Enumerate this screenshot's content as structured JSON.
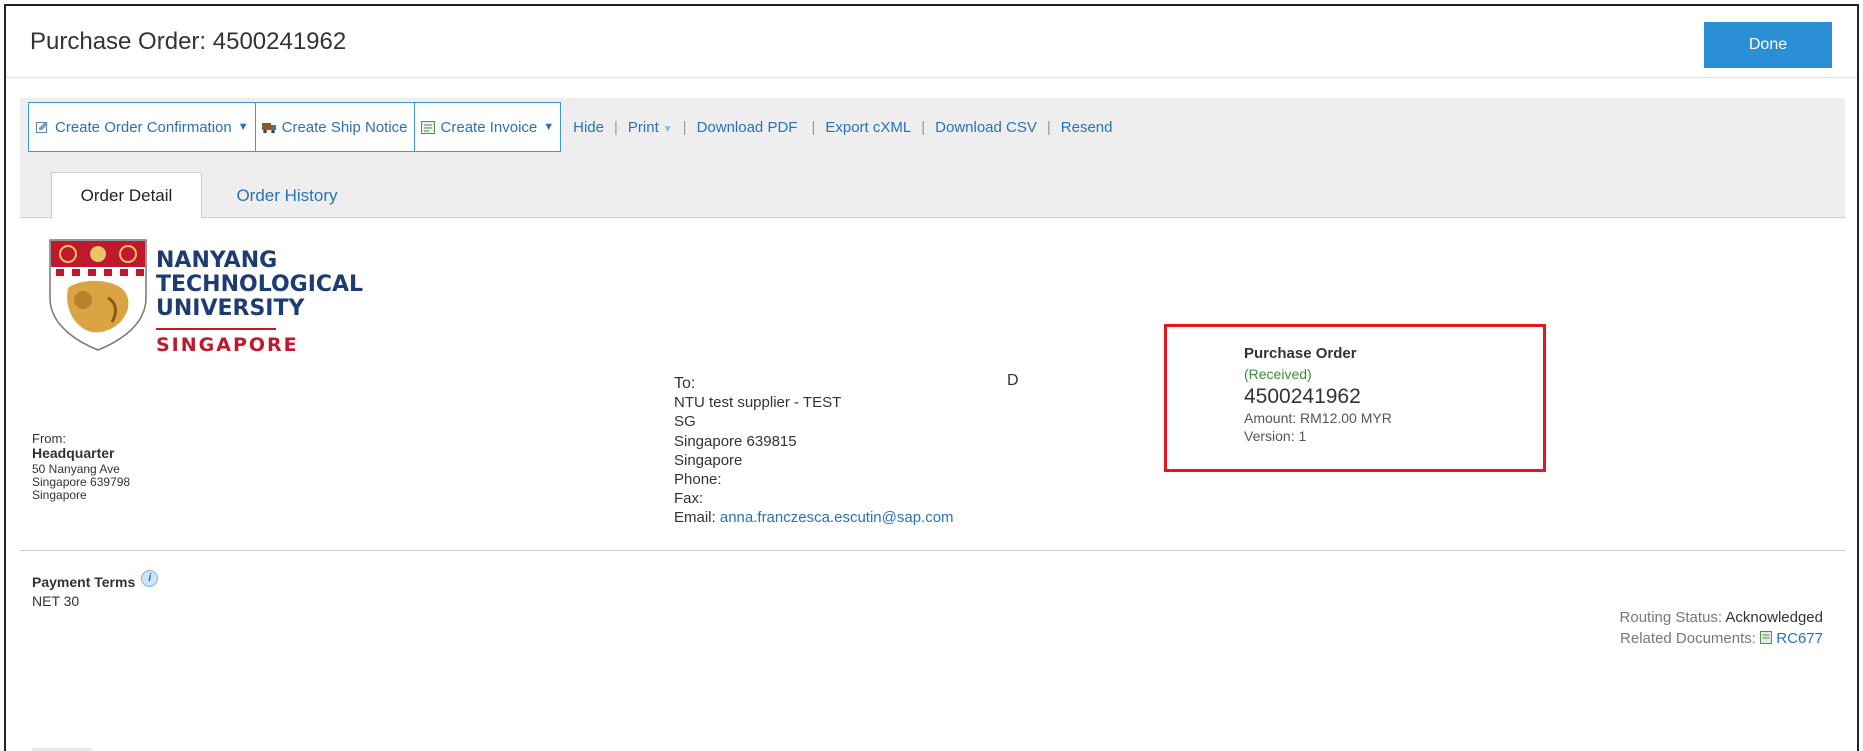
{
  "header": {
    "title": "Purchase Order: 4500241962",
    "done_label": "Done"
  },
  "toolbar": {
    "create_order_confirmation": "Create Order Confirmation",
    "create_ship_notice": "Create Ship Notice",
    "create_invoice": "Create Invoice",
    "links": {
      "hide": "Hide",
      "print": "Print",
      "download_pdf": "Download PDF",
      "export_cxml": "Export cXML",
      "download_csv": "Download CSV",
      "resend": "Resend"
    },
    "separator": "|"
  },
  "tabs": [
    {
      "label": "Order Detail",
      "active": true
    },
    {
      "label": "Order History",
      "active": false
    }
  ],
  "logo": {
    "line1": "NANYANG",
    "line2": "TECHNOLOGICAL",
    "line3": "UNIVERSITY",
    "line4": "SINGAPORE"
  },
  "from": {
    "label": "From:",
    "name": "Headquarter",
    "address1": "50 Nanyang Ave",
    "address2": "Singapore 639798",
    "country": "Singapore"
  },
  "to": {
    "label": "To:",
    "supplier": "NTU test supplier - TEST",
    "line1": "SG",
    "line2": "Singapore 639815",
    "line3": "Singapore",
    "phone": "Phone:",
    "fax": "Fax:",
    "email_label": "Email:",
    "email": "anna.franczesca.escutin@sap.com"
  },
  "marker": "D",
  "purchase_order": {
    "label": "Purchase Order",
    "status": "(Received)",
    "number": "4500241962",
    "amount": "Amount: RM12.00 MYR",
    "version": "Version: 1"
  },
  "payment": {
    "label": "Payment Terms",
    "value": "NET 30"
  },
  "routing": {
    "status_label": "Routing Status:",
    "status_value": "Acknowledged",
    "related_label": "Related Documents:",
    "related_value": "RC677"
  },
  "colors": {
    "accent": "#2a8fd5",
    "link": "#2a72b5",
    "status_green": "#3a8f3a",
    "highlight_red": "#e8151b",
    "ntu_blue": "#1d3c74",
    "ntu_red": "#c0192e"
  },
  "icons": {
    "order_confirmation": "checkbox-pencil-icon",
    "ship_notice": "truck-icon",
    "invoice": "invoice-icon",
    "info": "info-icon",
    "document": "document-icon",
    "dropdown": "caret-down-icon"
  }
}
